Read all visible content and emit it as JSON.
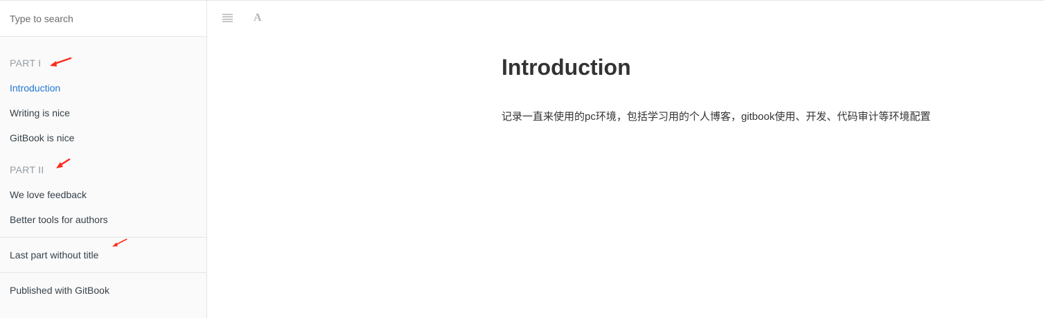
{
  "search": {
    "placeholder": "Type to search"
  },
  "sidebar": {
    "part1": {
      "title": "PART I",
      "items": [
        {
          "label": "Introduction",
          "active": true
        },
        {
          "label": "Writing is nice",
          "active": false
        },
        {
          "label": "GitBook is nice",
          "active": false
        }
      ]
    },
    "part2": {
      "title": "PART II",
      "items": [
        {
          "label": "We love feedback",
          "active": false
        },
        {
          "label": "Better tools for authors",
          "active": false
        }
      ]
    },
    "last_part": {
      "items": [
        {
          "label": "Last part without title",
          "active": false
        }
      ]
    },
    "footer_link": "Published with GitBook"
  },
  "toolbar": {
    "icons": [
      "menu-lines-icon",
      "font-settings-icon"
    ],
    "font_glyph": "A"
  },
  "main": {
    "title": "Introduction",
    "body": "记录一直来使用的pc环境，包括学习用的个人博客，gitbook使用、开发、代码审计等环境配置"
  },
  "colors": {
    "active_link": "#2177d1",
    "part_header": "#939da3",
    "annotation_arrow": "#ff2a1a",
    "sidebar_bg": "#fafafa"
  }
}
